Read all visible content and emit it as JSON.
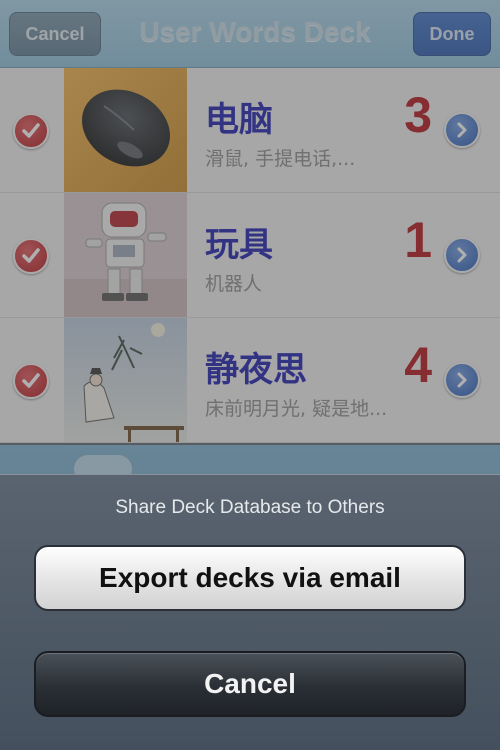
{
  "navbar": {
    "cancel_label": "Cancel",
    "title": "User Words Deck",
    "done_label": "Done"
  },
  "decks": [
    {
      "word": "电脑",
      "subtitle": "滑鼠, 手提电话,...",
      "count": "3",
      "image": "computer-mouse"
    },
    {
      "word": "玩具",
      "subtitle": "机器人",
      "count": "1",
      "image": "toy-robot"
    },
    {
      "word": "静夜思",
      "subtitle": "床前明月光, 疑是地...",
      "count": "4",
      "image": "poet-moon-painting"
    }
  ],
  "action_sheet": {
    "title": "Share Deck Database to Others",
    "export_label": "Export decks via email",
    "cancel_label": "Cancel"
  },
  "colors": {
    "word": "#1c1cb0",
    "count": "#b3121a",
    "check": "#b3141a",
    "disclosure": "#2358b6"
  }
}
